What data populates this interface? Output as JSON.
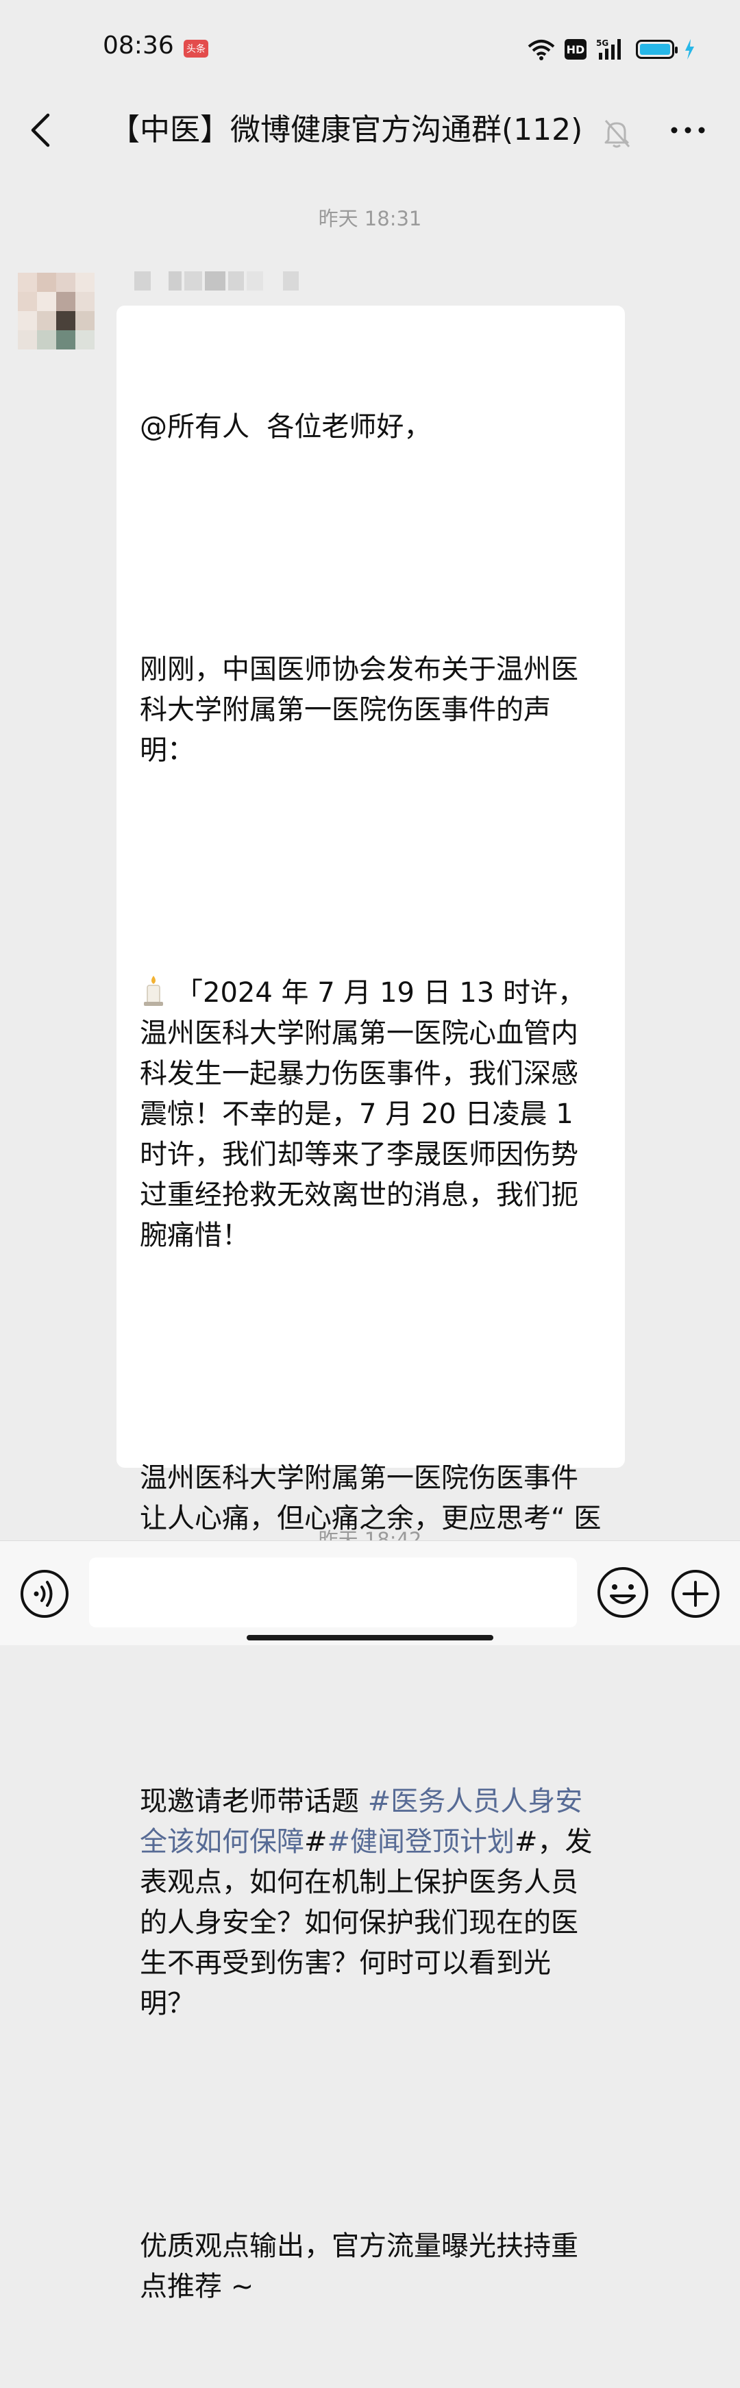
{
  "status_bar": {
    "time": "08:36",
    "app_badge": "头条",
    "hd_label": "HD",
    "network_label": "5G",
    "battery_level_percent": 100
  },
  "header": {
    "title": "【中医】微博健康官方沟通群(112)"
  },
  "timestamps": [
    "昨天 18:31",
    "昨天 18:42"
  ],
  "message": {
    "lines": [
      "@所有人  各位老师好，",
      "",
      "刚刚，中国医师协会发布关于温州医科大学附属第一医院伤医事件的声明：",
      "",
      "「2024 年 7 月 19 日 13 时许，温州医科大学附属第一医院心血管内科发生一起暴力伤医事件，我们深感震惊！不幸的是，7 月 20 日凌晨 1 时许，我们却等来了李晟医师因伤势过重经抢救无效离世的消息，我们扼腕痛惜！",
      "",
      "温州医科大学附属第一医院伤医事件让人心痛，但心痛之余，更应思考“ 医务人员的人身安全保护 ”的重要性。",
      "",
      "",
      "",
      "优质观点输出，官方流量曝光扶持重点推荐 ~"
    ],
    "invite_prefix": "现邀请老师带话题 ",
    "hashtag_1": "#医务人员人身安全该如何保障",
    "hashtag_sep": "#",
    "hashtag_2": "#健闻登顶计划",
    "invite_suffix": "#，发表观点，如何在机制上保护医务人员的人身安全？如何保护我们现在的医生不再受到伤害？何时可以看到光明？"
  },
  "colors": {
    "background": "#ededed",
    "bubble": "#ffffff",
    "hashtag": "#576b95",
    "timestamp": "#9a9a9a"
  },
  "icons": [
    "back-arrow-icon",
    "mute-bell-icon",
    "more-dots-icon",
    "candle-icon",
    "voice-icon",
    "emoji-icon",
    "plus-icon",
    "wifi-icon",
    "signal-icon",
    "battery-icon"
  ]
}
